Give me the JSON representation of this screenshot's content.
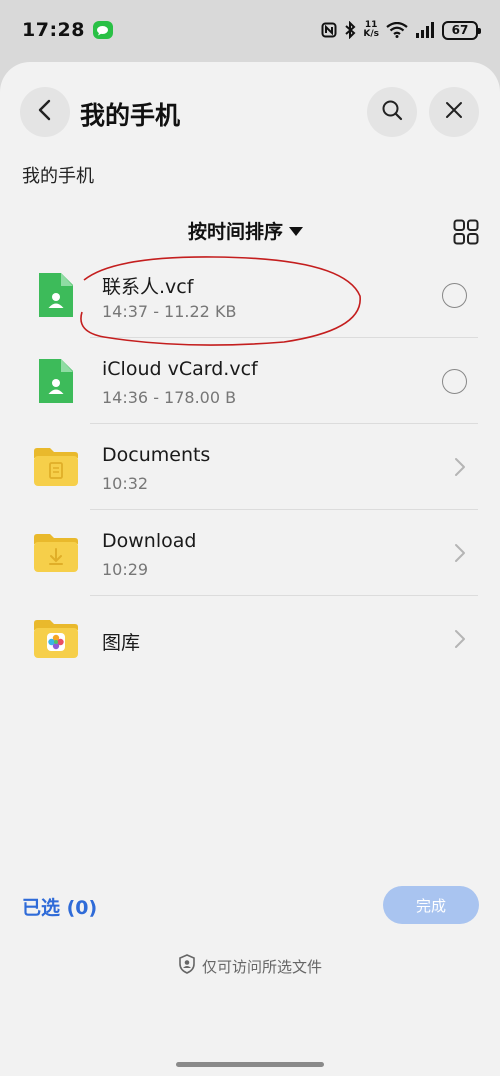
{
  "status": {
    "time": "17:28",
    "net_speed_value": "11",
    "net_speed_unit": "K/s",
    "battery": "67"
  },
  "header": {
    "title": "我的手机"
  },
  "breadcrumb": "我的手机",
  "sort": {
    "label": "按时间排序"
  },
  "files": [
    {
      "name": "联系人.vcf",
      "meta": "14:37 - 11.22 KB",
      "kind": "vcf"
    },
    {
      "name": "iCloud vCard.vcf",
      "meta": "14:36 - 178.00 B",
      "kind": "vcf"
    },
    {
      "name": "Documents",
      "meta": "10:32",
      "kind": "folder-doc"
    },
    {
      "name": "Download",
      "meta": "10:29",
      "kind": "folder-download"
    },
    {
      "name": "图库",
      "meta": "",
      "kind": "folder-gallery"
    }
  ],
  "footer": {
    "selected": "已选 (0)",
    "done": "完成",
    "privacy": "仅可访问所选文件"
  },
  "colors": {
    "accent": "#2f6bd8",
    "vcf_green": "#3dbb5a",
    "folder_yellow": "#f6cf4a",
    "annotation_red": "#c41e1e"
  }
}
